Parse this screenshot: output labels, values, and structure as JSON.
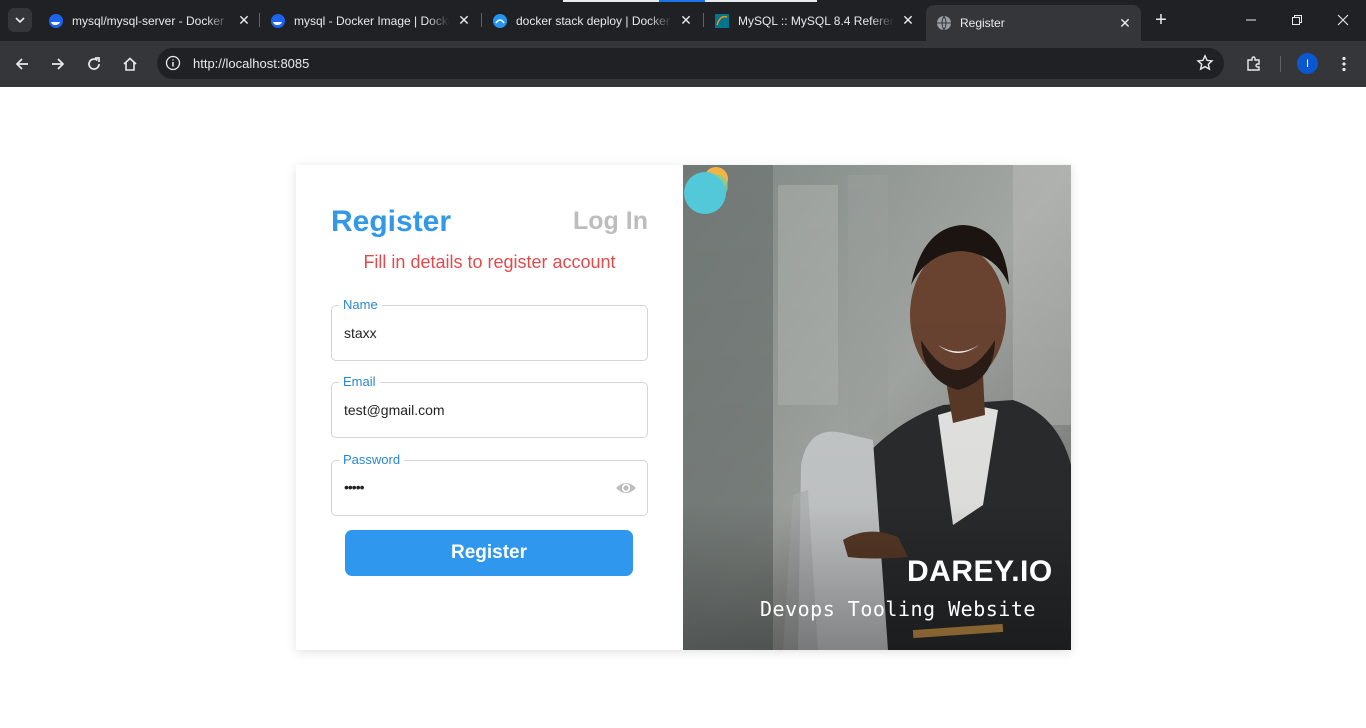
{
  "browser": {
    "tabs": [
      {
        "title": "mysql/mysql-server - Docker",
        "icon": "docker-icon"
      },
      {
        "title": "mysql - Docker Image | Docker",
        "icon": "docker-icon"
      },
      {
        "title": "docker stack deploy | Docker",
        "icon": "docker-docs-icon"
      },
      {
        "title": "MySQL :: MySQL 8.4 Reference",
        "icon": "mysql-icon"
      },
      {
        "title": "Register",
        "icon": "globe-icon",
        "active": true
      }
    ],
    "url": "http://localhost:8085",
    "profile_initial": "I"
  },
  "page": {
    "register_tab": "Register",
    "login_tab": "Log In",
    "subtitle": "Fill in details to register account",
    "fields": {
      "name": {
        "label": "Name",
        "value": "staxx"
      },
      "email": {
        "label": "Email",
        "value": "test@gmail.com"
      },
      "password": {
        "label": "Password",
        "value": "•••••"
      }
    },
    "submit_label": "Register",
    "brand": {
      "name": "DAREY.IO",
      "tagline": "Devops Tooling Website"
    }
  },
  "colors": {
    "accent": "#2f98ee",
    "title_blue": "#3399e6",
    "subtitle_red": "#e14b4b",
    "inactive_tab": "#bdbdbd"
  }
}
